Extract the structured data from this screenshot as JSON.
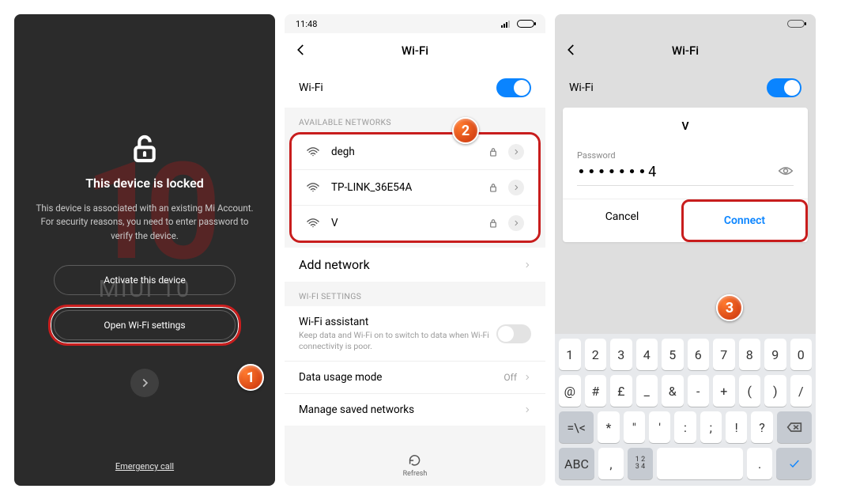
{
  "badges": {
    "one": "1",
    "two": "2",
    "three": "3"
  },
  "p1": {
    "bg_number": "10",
    "miui": "MIUI 10",
    "title": "This device is locked",
    "desc": "This device is associated with an existing Mi Account. For security reasons, you need to enter password to verify the device.",
    "btn_activate": "Activate this device",
    "btn_wifi": "Open Wi-Fi settings",
    "emergency": "Emergency call"
  },
  "p2": {
    "time": "11:48",
    "header": "Wi-Fi",
    "wifi_label": "Wi-Fi",
    "section_available": "AVAILABLE NETWORKS",
    "networks": [
      {
        "name": "degh"
      },
      {
        "name": "TP-LINK_36E54A"
      },
      {
        "name": "V"
      }
    ],
    "add_network": "Add network",
    "section_settings": "WI-FI SETTINGS",
    "assistant_title": "Wi-Fi assistant",
    "assistant_desc": "Keep data and Wi-Fi on to switch to data when Wi-Fi connectivity is poor.",
    "data_mode": "Data usage mode",
    "data_mode_val": "Off",
    "manage_saved": "Manage saved networks",
    "refresh": "Refresh"
  },
  "p3": {
    "header": "Wi-Fi",
    "wifi_label": "Wi-Fi",
    "network": "V",
    "password_label": "Password",
    "password_value": "•••••••4",
    "btn_cancel": "Cancel",
    "btn_connect": "Connect",
    "kbd": {
      "r1": [
        "1",
        "2",
        "3",
        "4",
        "5",
        "6",
        "7",
        "8",
        "9",
        "0"
      ],
      "r2": [
        "@",
        "#",
        "£",
        "_",
        "&",
        "-",
        "+",
        "(",
        ")",
        "/"
      ],
      "r3_lead": "=\\<",
      "r3": [
        "*",
        "\"",
        "'",
        ":",
        ";",
        "!",
        "?"
      ],
      "r4_abc": "ABC",
      "r4_comma": ",",
      "r4_center_top": "1 2",
      "r4_center_bot": "3 4",
      "r4_dot": "."
    }
  }
}
